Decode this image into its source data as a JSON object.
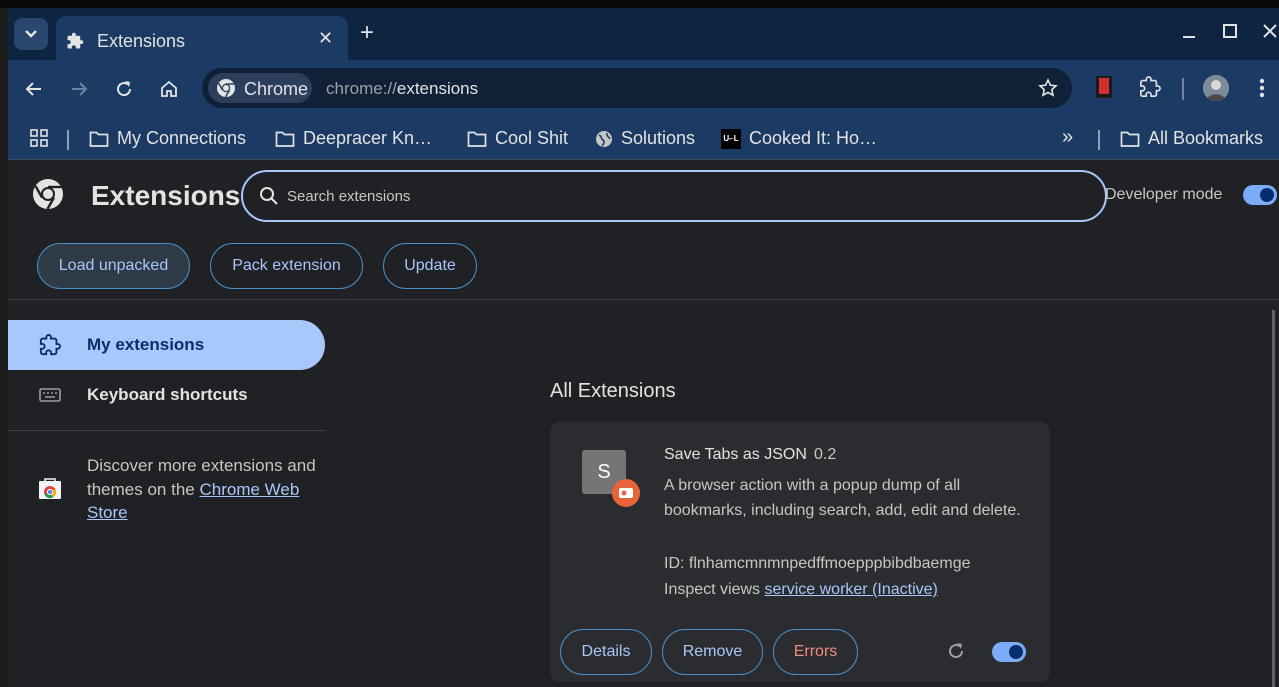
{
  "browser": {
    "tab": {
      "title": "Extensions",
      "close_label": "✕"
    },
    "new_tab_label": "+",
    "omnibox": {
      "site_chip": "Chrome",
      "url_scheme": "chrome://",
      "url_path": "extensions"
    },
    "bookmarks": [
      {
        "label": "My Connections",
        "icon": "folder-icon"
      },
      {
        "label": "Deepracer Kn…",
        "icon": "folder-icon"
      },
      {
        "label": "Cool Shit",
        "icon": "folder-icon"
      },
      {
        "label": "Solutions",
        "icon": "globe-icon"
      },
      {
        "label": "Cooked It: Ho…",
        "icon": "site-favicon"
      }
    ],
    "overflow_label": "»",
    "all_bookmarks_label": "All Bookmarks"
  },
  "page": {
    "title": "Extensions",
    "search_placeholder": "Search extensions",
    "developer_mode_label": "Developer mode",
    "developer_mode_on": true,
    "actions": {
      "load_unpacked": "Load unpacked",
      "pack_extension": "Pack extension",
      "update": "Update"
    },
    "sidebar": {
      "my_extensions": "My extensions",
      "keyboard_shortcuts": "Keyboard shortcuts",
      "discover_text": "Discover more extensions and themes on the ",
      "discover_link": "Chrome Web Store"
    },
    "section_title": "All Extensions",
    "extension": {
      "icon_letter": "S",
      "name": "Save Tabs as JSON",
      "version": "0.2",
      "description": "A browser action with a popup dump of all bookmarks, including search, add, edit and delete.",
      "id_text": "ID: flnhamcmnmnpedffmoepppbibdbaemge",
      "inspect_label": "Inspect views ",
      "inspect_link": "service worker (Inactive)",
      "buttons": {
        "details": "Details",
        "remove": "Remove",
        "errors": "Errors"
      },
      "enabled": true
    }
  },
  "colors": {
    "accent": "#a8c7fa",
    "error": "#f28b82",
    "badge": "#e8633a",
    "tab_strip": "#0e2541",
    "toolbar": "#1b3a64"
  }
}
